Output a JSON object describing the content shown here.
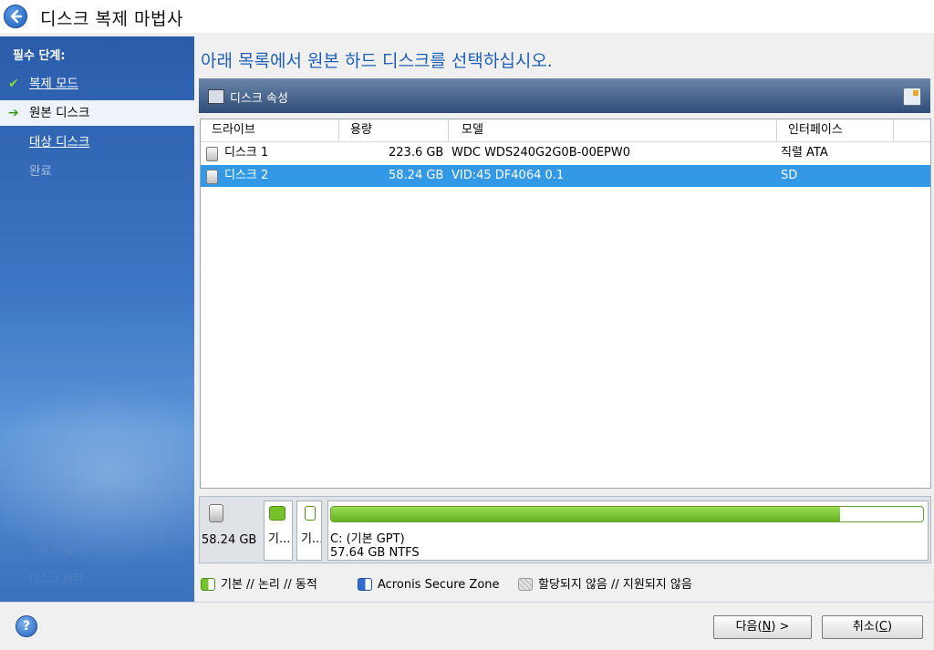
{
  "window": {
    "title": "디스크 복제 마법사"
  },
  "sidebar": {
    "header": "필수 단계:",
    "steps": [
      {
        "label": "복제 모드",
        "state": "done"
      },
      {
        "label": "원본 디스크",
        "state": "current"
      },
      {
        "label": "대상 디스크",
        "state": "link"
      },
      {
        "label": "완료",
        "state": "disabled"
      }
    ],
    "faded_1": "선택 단계:",
    "faded_2": "디스크 제외"
  },
  "main": {
    "heading": "아래 목록에서 원본 하드 디스크를 선택하십시오.",
    "properties_label": "디스크 속성"
  },
  "table": {
    "columns": [
      "드라이브",
      "용량",
      "모델",
      "인터페이스"
    ],
    "rows": [
      {
        "drive": "디스크 1",
        "capacity": "223.6 GB",
        "model": "WDC WDS240G2G0B-00EPW0",
        "interface": "직렬 ATA",
        "selected": false
      },
      {
        "drive": "디스크 2",
        "capacity": "58.24 GB",
        "model": "VID:45 DF4064 0.1",
        "interface": "SD",
        "selected": true
      }
    ]
  },
  "diskmap": {
    "size": "58.24 GB",
    "small_part_1": "기...",
    "small_part_2": "기...",
    "main_part_label": "C: (기본 GPT)",
    "main_part_info": "57.64 GB  NTFS",
    "main_part_used_fraction": 0.86
  },
  "legend": {
    "basic": "기본 // 논리 // 동적",
    "acronis": "Acronis Secure Zone",
    "unallocated": "할당되지 않음 // 지원되지 않음"
  },
  "buttons": {
    "next_prefix": "다음(",
    "next_key": "N",
    "next_suffix": ") >",
    "cancel_prefix": "취소(",
    "cancel_key": "C",
    "cancel_suffix": ")",
    "help": "?"
  },
  "colors": {
    "selected_row": "#3399e6",
    "heading": "#1f5fb7",
    "partition_fill": "#77c22a"
  }
}
